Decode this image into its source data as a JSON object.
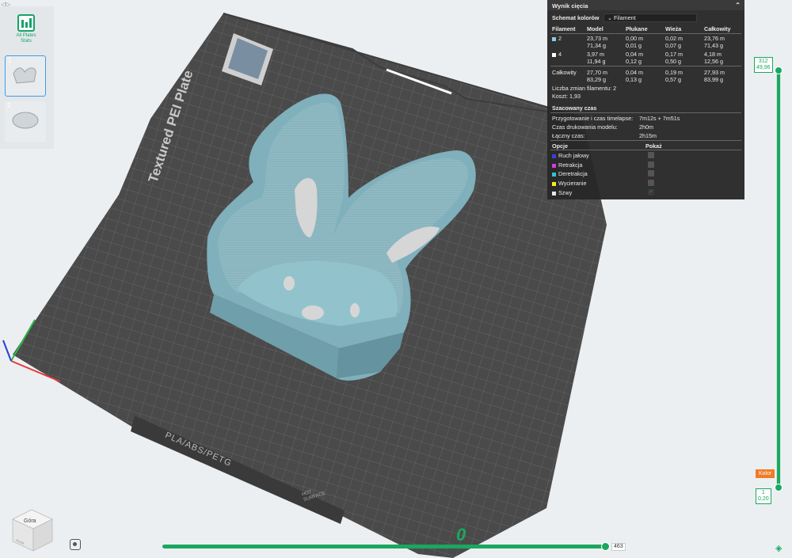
{
  "plates": {
    "stats_label_1": "All Plates",
    "stats_label_2": "Stats",
    "plate1_num": "1",
    "plate2_num": "2"
  },
  "bed": {
    "title": "Textured PEI Plate",
    "material_label": "PLA/ABS/PETG",
    "warning_label_1": "HOT",
    "warning_label_2": "SURFACE",
    "corner_glyph": "0"
  },
  "slice_panel": {
    "title": "Wynik cięcia",
    "color_scheme_label": "Schemat kolorów",
    "color_scheme_value": "Filament",
    "headers": [
      "Filament",
      "Model",
      "Płukane",
      "Wieża",
      "Całkowity"
    ],
    "rows": [
      {
        "id": "2",
        "color": "#8ecae6",
        "model": [
          "23,73 m",
          "71,34 g"
        ],
        "flush": [
          "0,00 m",
          "0,01 g"
        ],
        "tower": [
          "0,02 m",
          "0,07 g"
        ],
        "total": [
          "23,76 m",
          "71,43 g"
        ]
      },
      {
        "id": "4",
        "color": "#ffffff",
        "model": [
          "3,97 m",
          "11,94 g"
        ],
        "flush": [
          "0,04 m",
          "0,12 g"
        ],
        "tower": [
          "0,17 m",
          "0,50 g"
        ],
        "total": [
          "4,18 m",
          "12,56 g"
        ]
      }
    ],
    "total_row": {
      "label": "Całkowity",
      "model": [
        "27,70 m",
        "83,29 g"
      ],
      "flush": [
        "0,04 m",
        "0,13 g"
      ],
      "tower": [
        "0,19 m",
        "0,57 g"
      ],
      "total": [
        "27,93 m",
        "83,99 g"
      ]
    },
    "filament_changes": "Liczba zmian filamentu:  2",
    "cost": "Koszt:  1,93",
    "estimated_time_label": "Szacowany czas",
    "prep_time_label": "Przygotowanie i czas timelapse:",
    "prep_time_value": "7m12s + 7m51s",
    "model_time_label": "Czas drukowania modelu:",
    "model_time_value": "2h0m",
    "total_time_label": "Łączny czas:",
    "total_time_value": "2h15m",
    "options_label": "Opcje",
    "show_label": "Pokaż",
    "options": [
      {
        "label": "Ruch jałowy",
        "color": "#3a3fd8",
        "checked": false
      },
      {
        "label": "Retrakcja",
        "color": "#d63adf",
        "checked": false
      },
      {
        "label": "Deretrakcja",
        "color": "#33c2cf",
        "checked": false
      },
      {
        "label": "Wycieranie",
        "color": "#f2ee16",
        "checked": false
      },
      {
        "label": "Szwy",
        "color": "#e6e6e6",
        "checked": true
      }
    ]
  },
  "layer_slider": {
    "top_layer": "312",
    "top_height": "49,96",
    "bottom_layer": "1",
    "bottom_height": "0,20",
    "color_button": "Kolor"
  },
  "move_slider": {
    "value": "463"
  },
  "view_cube": {
    "label": "Góra",
    "front_label": "Przód"
  }
}
